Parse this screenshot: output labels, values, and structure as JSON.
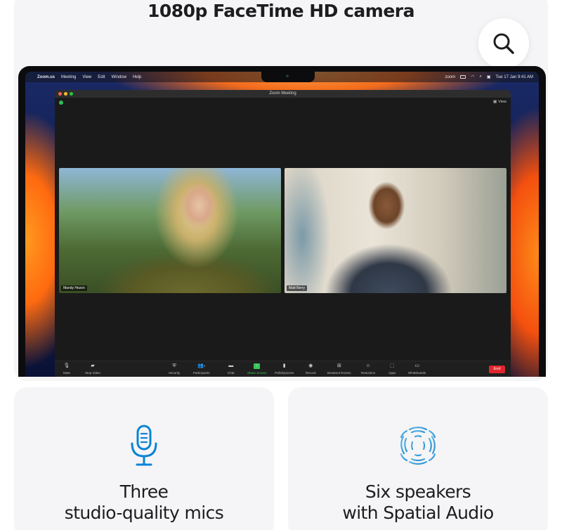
{
  "headline": "1080p FaceTime HD camera",
  "menubar": {
    "app": "Zoom.us",
    "items": [
      "Meeting",
      "View",
      "Edit",
      "Window",
      "Help"
    ],
    "status_zoom": "zoom",
    "datetime": "Tue 17 Jan  9:41 AM"
  },
  "zoom_window": {
    "title": "Zoom Meeting",
    "view_label": "View",
    "participants": [
      {
        "name": "Mandy Hezon"
      },
      {
        "name": "Matt Berry"
      }
    ],
    "participant_count": "2",
    "toolbar": {
      "mute": "Mute",
      "stop_video": "Stop Video",
      "security": "Security",
      "participants": "Participants",
      "chat": "Chat",
      "share_screen": "Share Screen",
      "polls": "Polls/Quizzes",
      "record": "Record",
      "breakout": "Breakout Rooms",
      "reactions": "Reactions",
      "apps": "Apps",
      "whiteboards": "Whiteboards",
      "end": "End"
    }
  },
  "features": [
    {
      "line1": "Three",
      "line2": "studio-quality mics",
      "icon": "microphone-icon"
    },
    {
      "line1": "Six speakers",
      "line2": "with Spatial Audio",
      "icon": "spatial-audio-icon"
    }
  ],
  "colors": {
    "accent_blue": "#0a84d6",
    "share_green": "#35c759",
    "end_red": "#e0262d",
    "card_bg": "#f5f5f7"
  }
}
